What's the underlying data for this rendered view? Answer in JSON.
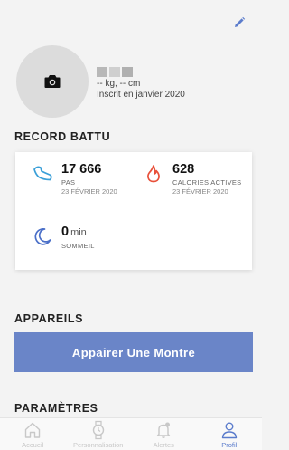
{
  "profile": {
    "stats": "-- kg, -- cm",
    "member_since": "Inscrit en janvier 2020"
  },
  "records": {
    "title": "RECORD BATTU",
    "steps": {
      "value": "17 666",
      "label": "PAS",
      "date": "23 FÉVRIER 2020",
      "icon": "shoe-icon"
    },
    "calories": {
      "value": "628",
      "label": "CALORIES ACTIVES",
      "date": "23 FÉVRIER 2020",
      "icon": "flame-icon"
    },
    "sleep": {
      "value": "0",
      "unit": "min",
      "label": "SOMMEIL",
      "icon": "moon-icon"
    }
  },
  "devices": {
    "title": "APPAREILS",
    "pair_button": "Appairer Une Montre"
  },
  "settings": {
    "title": "PARAMÈTRES"
  },
  "tabbar": {
    "items": [
      {
        "label": "Accueil",
        "icon": "home-icon"
      },
      {
        "label": "Personnalisation",
        "icon": "watch-icon"
      },
      {
        "label": "Alertes",
        "icon": "bell-icon"
      },
      {
        "label": "Profil",
        "icon": "person-icon",
        "active": true
      }
    ]
  },
  "colors": {
    "accent": "#5b7ccc",
    "button": "#6a85c8",
    "steps_icon": "#3a9fd8",
    "calories_icon": "#e8503a",
    "sleep_icon": "#4a6fc8"
  }
}
